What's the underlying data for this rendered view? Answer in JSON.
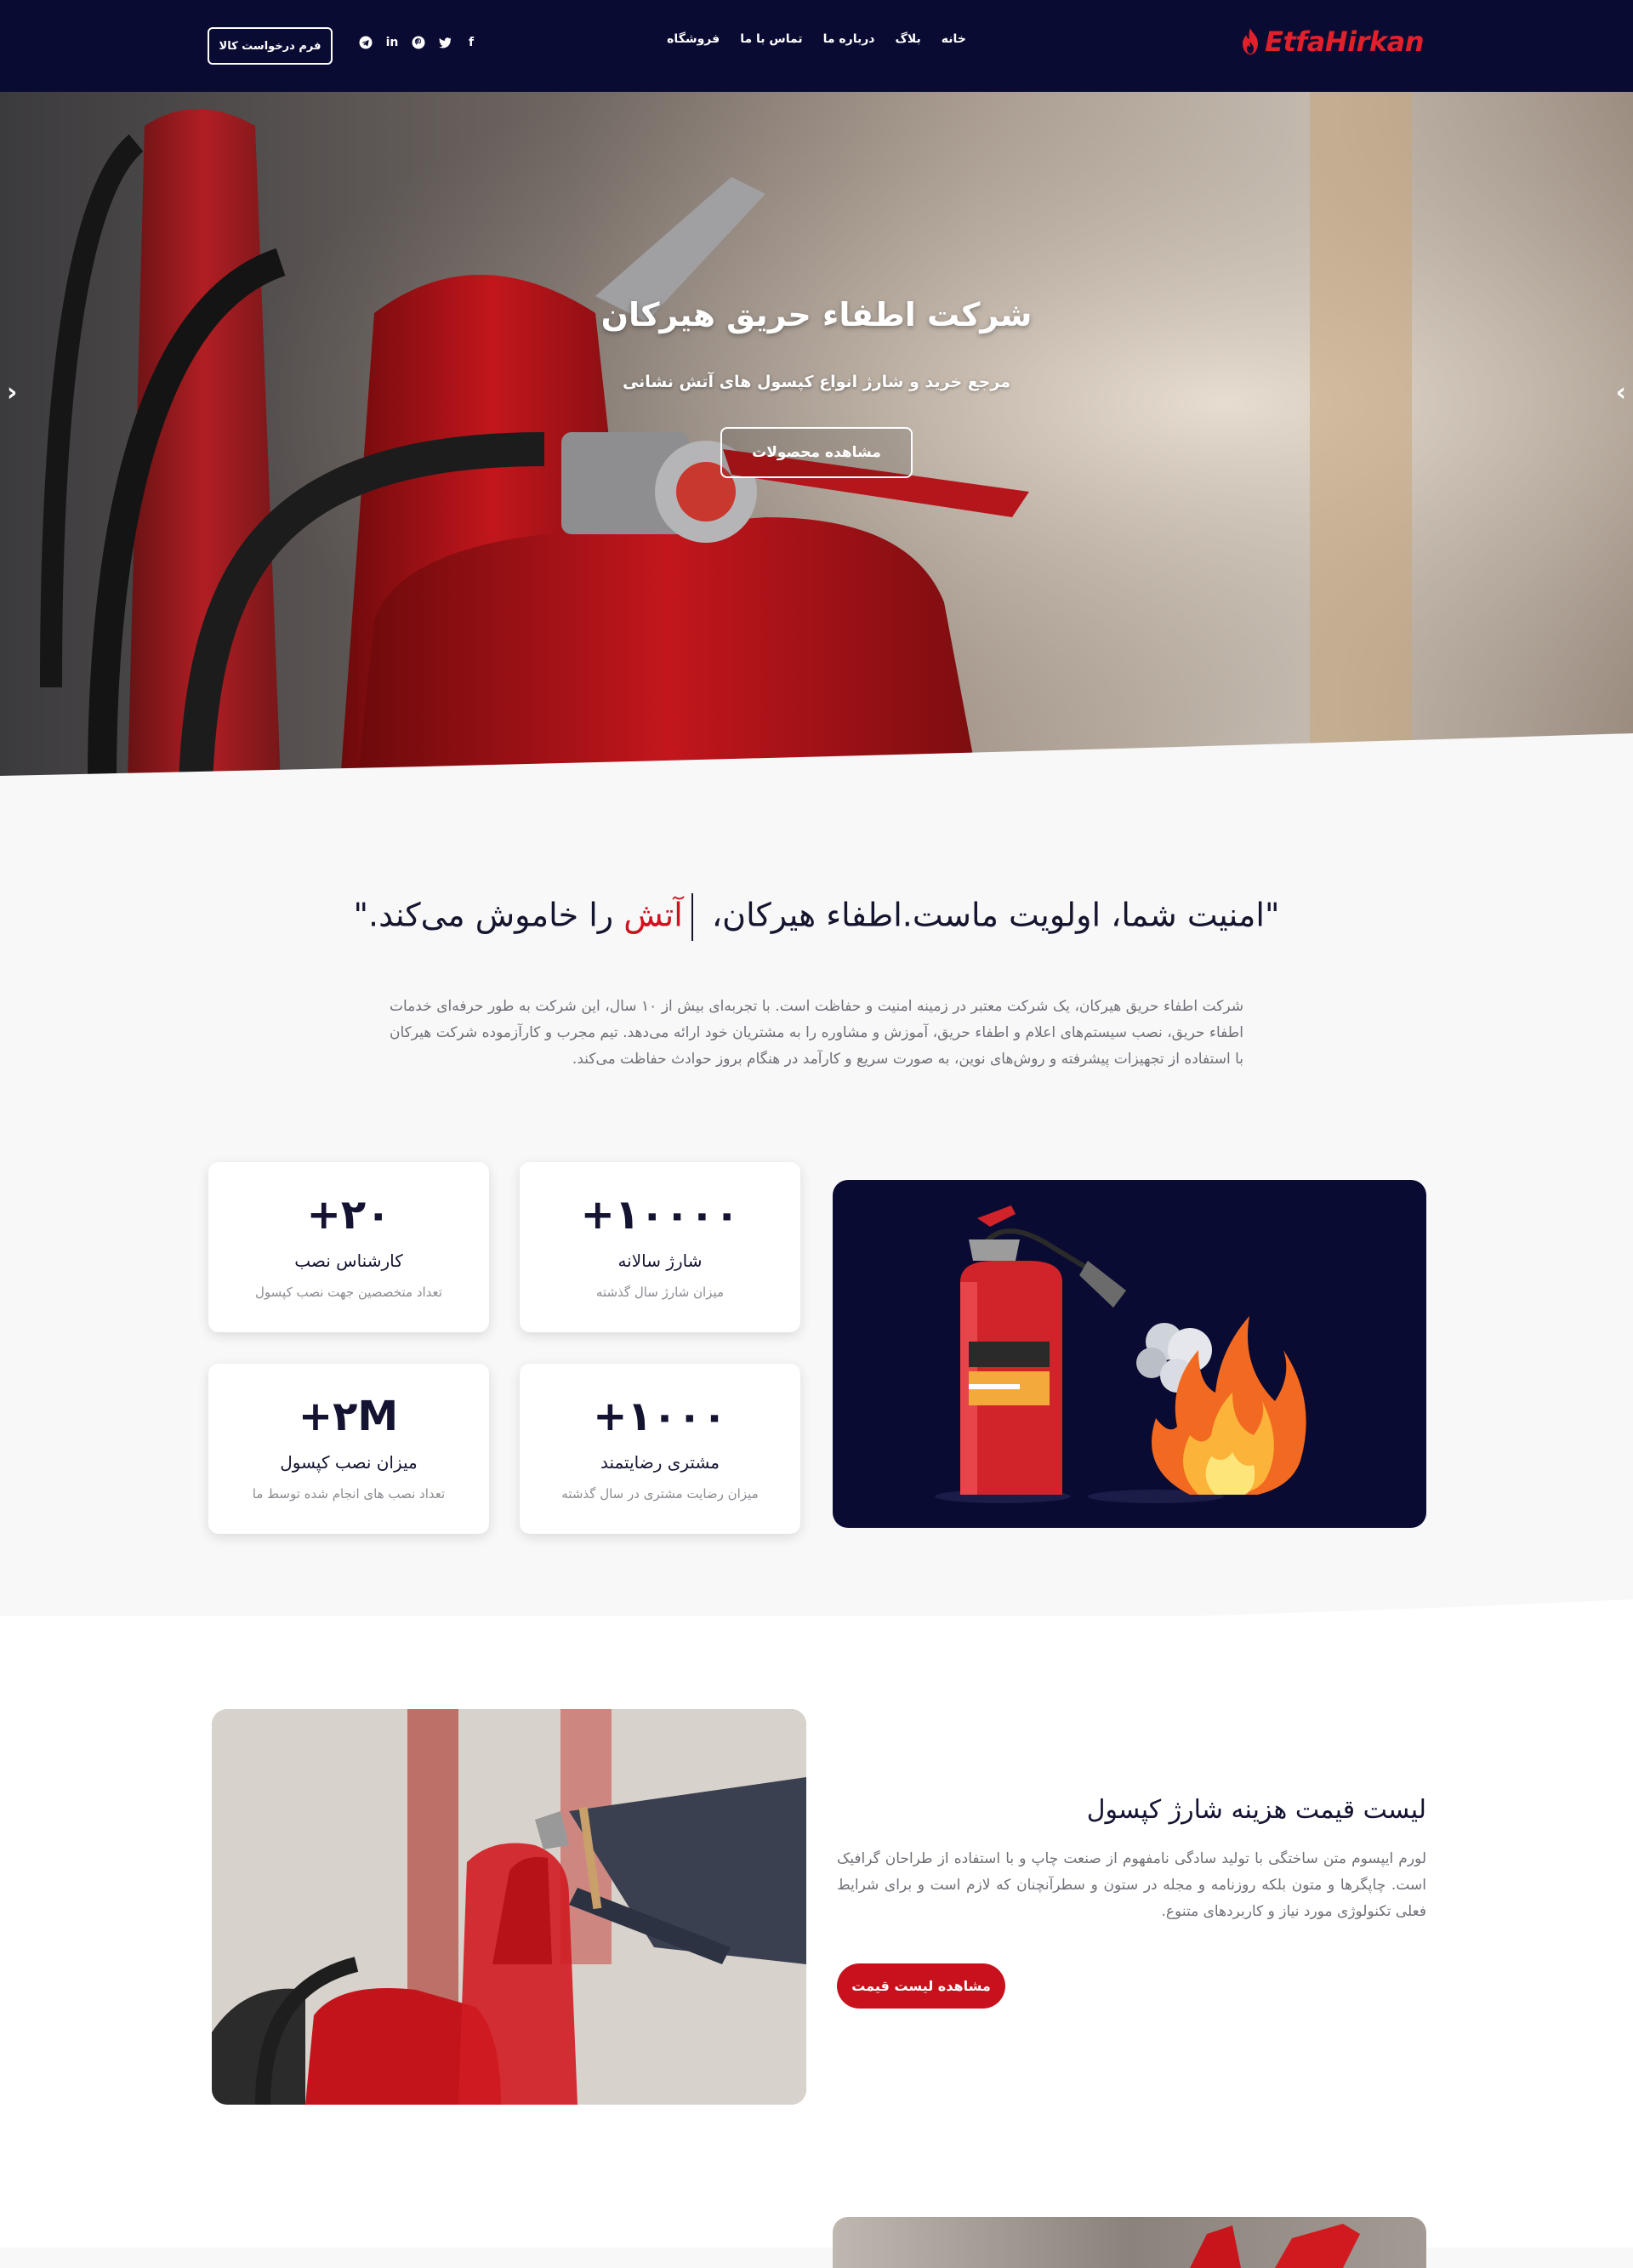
{
  "header": {
    "logo_text": "EtfaHirkan",
    "nav": [
      "خانه",
      "بلاگ",
      "درباره ما",
      "تماس با ما",
      "فروشگاه"
    ],
    "request_button": "فرم درخواست کالا",
    "socials": [
      "facebook-icon",
      "twitter-icon",
      "pinterest-icon",
      "linkedin-icon",
      "telegram-icon"
    ]
  },
  "hero": {
    "title": "شرکت اطفاء حریق هیرکان",
    "subtitle": "مرجع خرید و شارژ انواع کپسول های آتش نشانی",
    "button": "مشاهده محصولات",
    "prev_arrow": "‹",
    "next_arrow": "›"
  },
  "about": {
    "quote_start": "\"امنیت شما، اولویت ماست.اطفاء هیرکان، ",
    "quote_accent": "آتش",
    "quote_end": " را خاموش می‌کند.\"",
    "intro": "شرکت اطفاء حریق هیرکان، یک شرکت معتبر در زمینه امنیت و حفاظت است. با تجربه‌ای بیش از ۱۰ سال، این شرکت به طور حرفه‌ای خدمات اطفاء حریق، نصب سیستم‌های اعلام و اطفاء حریق، آموزش و مشاوره را به مشتریان خود ارائه می‌دهد. تیم مجرب و کارآزموده شرکت هیرکان با استفاده از تجهیزات پیشرفته و روش‌های نوین، به صورت سریع و کارآمد در هنگام بروز حوادث حفاظت می‌کند."
  },
  "stats": [
    {
      "number": "+۱۰۰۰۰",
      "label": "شارژ سالانه",
      "desc": "میزان شارژ سال گذشته"
    },
    {
      "number": "+۲۰",
      "label": "کارشناس نصب",
      "desc": "تعداد متخصصین جهت نصب کپسول"
    },
    {
      "number": "+۱۰۰۰",
      "label": "مشتری رضایتمند",
      "desc": "میزان رضایت مشتری در سال گذشته"
    },
    {
      "number": "+۲M",
      "label": "میزان نصب کپسول",
      "desc": "تعداد نصب های انجام شده توسط ما"
    }
  ],
  "price": {
    "title": "لیست قیمت هزینه شارژ کپسول",
    "text": "لورم ایپسوم متن ساختگی با تولید سادگی نامفهوم از صنعت چاپ و با استفاده از طراحان گرافیک است. چاپگرها و متون بلکه روزنامه و مجله در ستون و سطرآنچنان که لازم است و برای شرایط فعلی تکنولوژی مورد نیاز و کاربردهای متنوع.",
    "button": "مشاهده لیست قیمت"
  },
  "colors": {
    "navy": "#0a0b32",
    "brand_red": "#e0212b",
    "button_red": "#c8111d"
  }
}
